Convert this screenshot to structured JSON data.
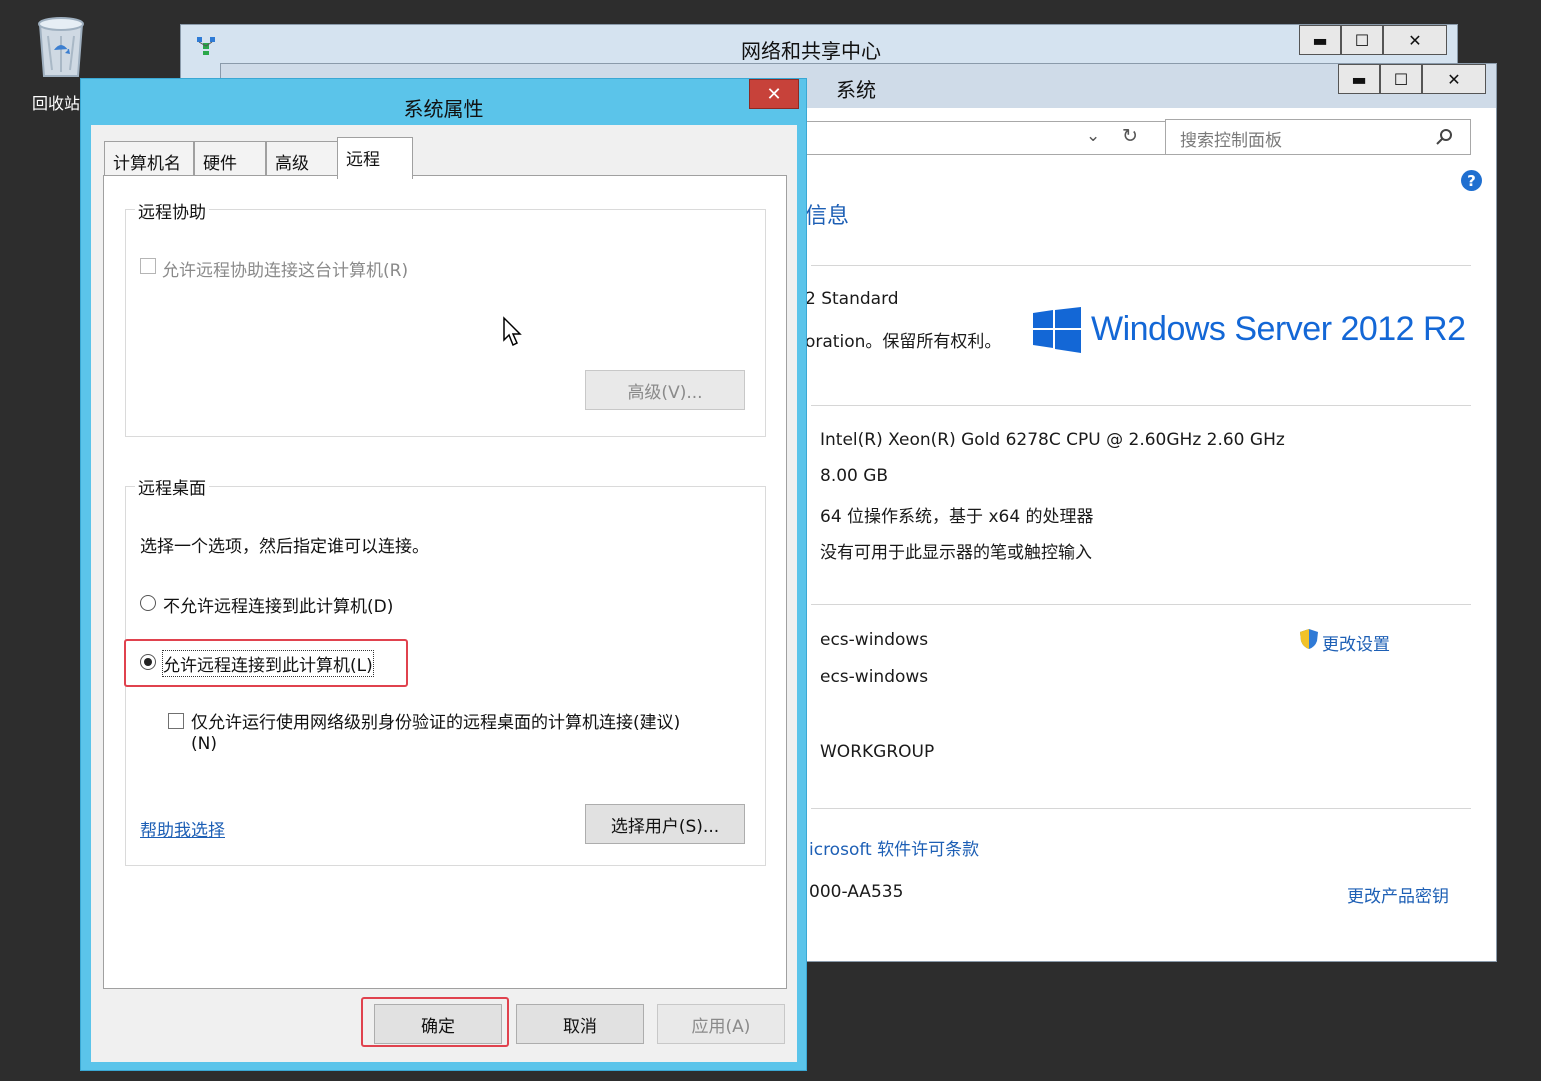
{
  "desktop": {
    "recycle_bin_label": "回收站"
  },
  "network_window": {
    "title": "网络和共享中心",
    "minimize": "▬",
    "maximize": "☐",
    "close": "✕"
  },
  "system_window": {
    "title": "系统",
    "minimize": "▬",
    "maximize": "☐",
    "close": "✕",
    "search_placeholder": "搜索控制面板",
    "heading_fragment": "信息",
    "edition": "2 Standard",
    "copyright": "oration。保留所有权利。",
    "logo_text": "Windows Server 2012 R2",
    "processor": "Intel(R) Xeon(R) Gold 6278C CPU @ 2.60GHz   2.60 GHz",
    "memory": "8.00 GB",
    "system_type": "64 位操作系统，基于 x64 的处理器",
    "pen_touch": "没有可用于此显示器的笔或触控输入",
    "computer_name": "ecs-windows",
    "full_computer_name": "ecs-windows",
    "workgroup": "WORKGROUP",
    "change_settings": "更改设置",
    "license_terms": "icrosoft 软件许可条款",
    "product_id": "000-AA535",
    "change_product_key": "更改产品密钥"
  },
  "dialog": {
    "title": "系统属性",
    "close": "✕",
    "tabs": [
      {
        "label": "计算机名"
      },
      {
        "label": "硬件"
      },
      {
        "label": "高级"
      },
      {
        "label": "远程"
      }
    ],
    "remote_assistance": {
      "group_label": "远程协助",
      "allow_label": "允许远程协助连接这台计算机(R)",
      "advanced_button": "高级(V)..."
    },
    "remote_desktop": {
      "group_label": "远程桌面",
      "description": "选择一个选项，然后指定谁可以连接。",
      "option_disallow": "不允许远程连接到此计算机(D)",
      "option_allow": "允许远程连接到此计算机(L)",
      "nla_label_line1": "仅允许运行使用网络级别身份验证的远程桌面的计算机连接(建议)",
      "nla_label_line2": "(N)",
      "help_link": "帮助我选择",
      "select_users_button": "选择用户(S)..."
    },
    "ok_button": "确定",
    "cancel_button": "取消",
    "apply_button": "应用(A)"
  },
  "colors": {
    "dialog_frame": "#5bc4ea",
    "highlight": "#e0424e",
    "link": "#1d5fb5",
    "close_red": "#c7423a"
  },
  "icons": [
    "recycle-bin-icon",
    "network-icon",
    "search-icon",
    "refresh-icon",
    "chevron-down-icon",
    "help-icon",
    "shield-icon",
    "windows-logo-icon",
    "mouse-cursor-icon"
  ]
}
